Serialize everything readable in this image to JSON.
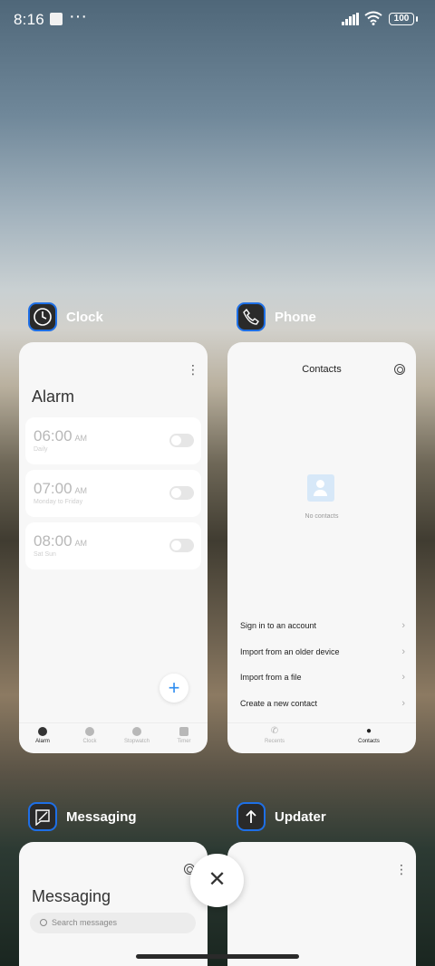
{
  "status_bar": {
    "time": "8:16",
    "dots": "···",
    "battery": "100"
  },
  "apps": {
    "clock": {
      "name": "Clock",
      "icon": "clock-icon",
      "title": "Alarm",
      "alarms": [
        {
          "time": "06:00",
          "ampm": "AM",
          "repeat": "Daily"
        },
        {
          "time": "07:00",
          "ampm": "AM",
          "repeat": "Monday to Friday"
        },
        {
          "time": "08:00",
          "ampm": "AM",
          "repeat": "Sat Sun"
        }
      ],
      "add": "+",
      "tabs": [
        "Alarm",
        "Clock",
        "Stopwatch",
        "Timer"
      ]
    },
    "phone": {
      "name": "Phone",
      "icon": "phone-icon",
      "title": "Contacts",
      "empty": "No contacts",
      "options": [
        "Sign in to an account",
        "Import from an older device",
        "Import from a file",
        "Create a new contact"
      ],
      "tabs": [
        "Recents",
        "Contacts"
      ]
    },
    "messaging": {
      "name": "Messaging",
      "icon": "message-icon",
      "title": "Messaging",
      "search_placeholder": "Search messages"
    },
    "updater": {
      "name": "Updater",
      "icon": "arrow-up-icon"
    }
  },
  "controls": {
    "close": "✕"
  },
  "colors": {
    "accent": "#2d8cf0",
    "icon_border": "#1e6fe6"
  }
}
